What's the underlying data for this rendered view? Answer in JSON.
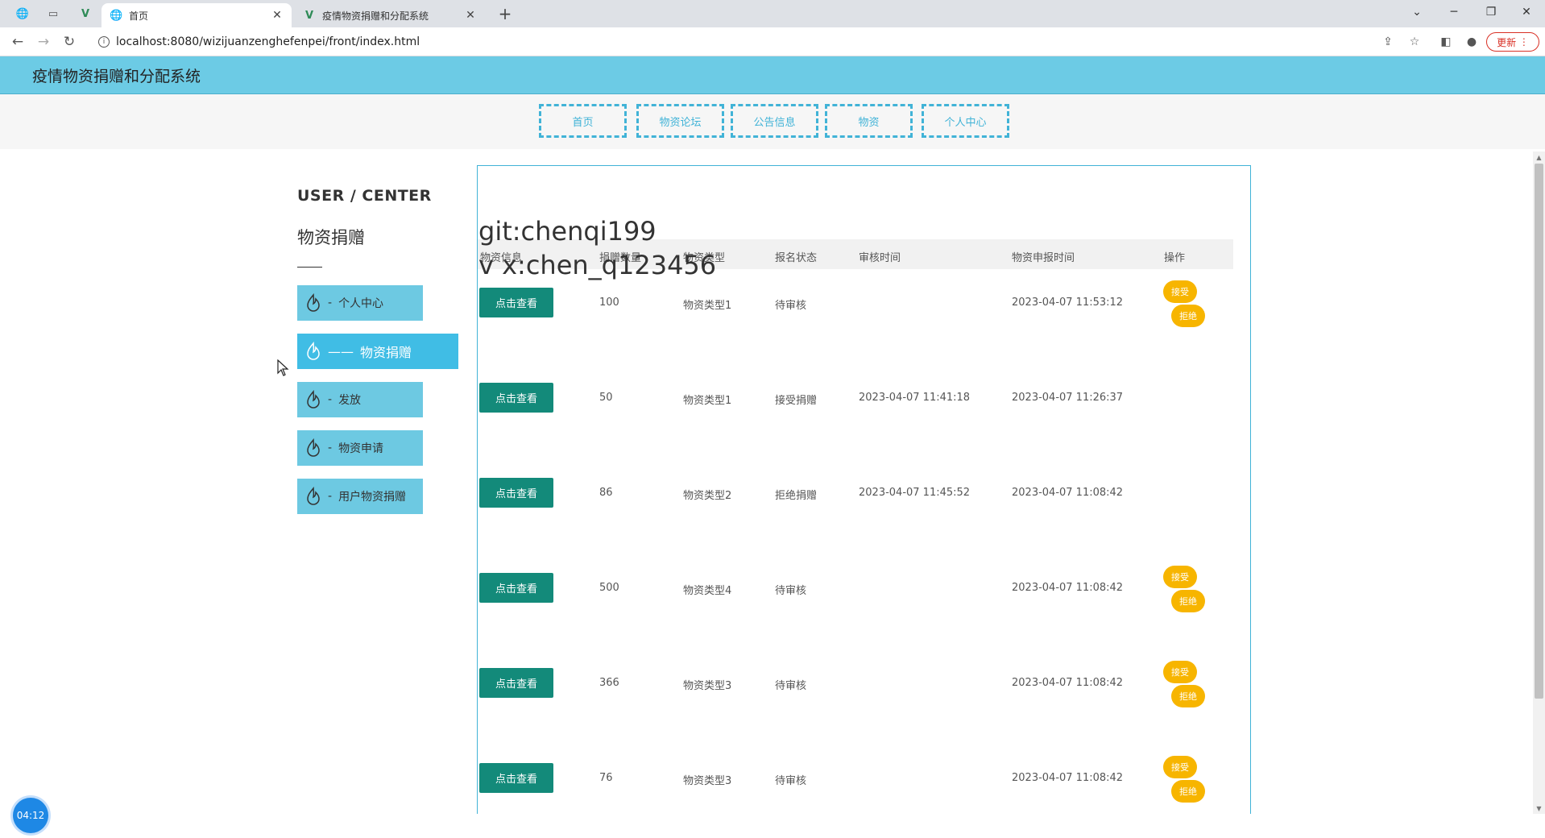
{
  "browser": {
    "tabs": [
      {
        "title": "首页",
        "icon": "globe-icon"
      },
      {
        "title": "疫情物资捐赠和分配系统",
        "icon": "vue-icon"
      }
    ],
    "url": "localhost:8080/wizijuanzenghefenpei/front/index.html",
    "update_label": "更新"
  },
  "site": {
    "title": "疫情物资捐赠和分配系统",
    "nav": [
      "首页",
      "物资论坛",
      "公告信息",
      "物资",
      "个人中心"
    ]
  },
  "sidebar": {
    "heading": "USER / CENTER",
    "subheading": "物资捐赠",
    "items": [
      {
        "label": "个人中心",
        "prefix": "-"
      },
      {
        "label": "物资捐赠",
        "prefix": "——"
      },
      {
        "label": "发放",
        "prefix": "-"
      },
      {
        "label": "物资申请",
        "prefix": "-"
      },
      {
        "label": "用户物资捐赠",
        "prefix": "-"
      }
    ]
  },
  "watermark": {
    "line1": "git:chenqi199",
    "line2": "v x:chen_q123456"
  },
  "table": {
    "headers": [
      "物资信息",
      "捐赠数量",
      "物资类型",
      "报名状态",
      "审核时间",
      "物资申报时间",
      "操作"
    ],
    "view_label": "点击查看",
    "accept_label": "接受",
    "reject_label": "拒绝",
    "rows": [
      {
        "qty": "100",
        "type": "物资类型1",
        "status": "待审核",
        "review_time": "",
        "report_time": "2023-04-07 11:53:12",
        "actions": true
      },
      {
        "qty": "50",
        "type": "物资类型1",
        "status": "接受捐赠",
        "review_time": "2023-04-07 11:41:18",
        "report_time": "2023-04-07 11:26:37",
        "actions": false
      },
      {
        "qty": "86",
        "type": "物资类型2",
        "status": "拒绝捐赠",
        "review_time": "2023-04-07 11:45:52",
        "report_time": "2023-04-07 11:08:42",
        "actions": false
      },
      {
        "qty": "500",
        "type": "物资类型4",
        "status": "待审核",
        "review_time": "",
        "report_time": "2023-04-07 11:08:42",
        "actions": true
      },
      {
        "qty": "366",
        "type": "物资类型3",
        "status": "待审核",
        "review_time": "",
        "report_time": "2023-04-07 11:08:42",
        "actions": true
      },
      {
        "qty": "76",
        "type": "物资类型3",
        "status": "待审核",
        "review_time": "",
        "report_time": "2023-04-07 11:08:42",
        "actions": true
      }
    ]
  },
  "timer": "04:12"
}
